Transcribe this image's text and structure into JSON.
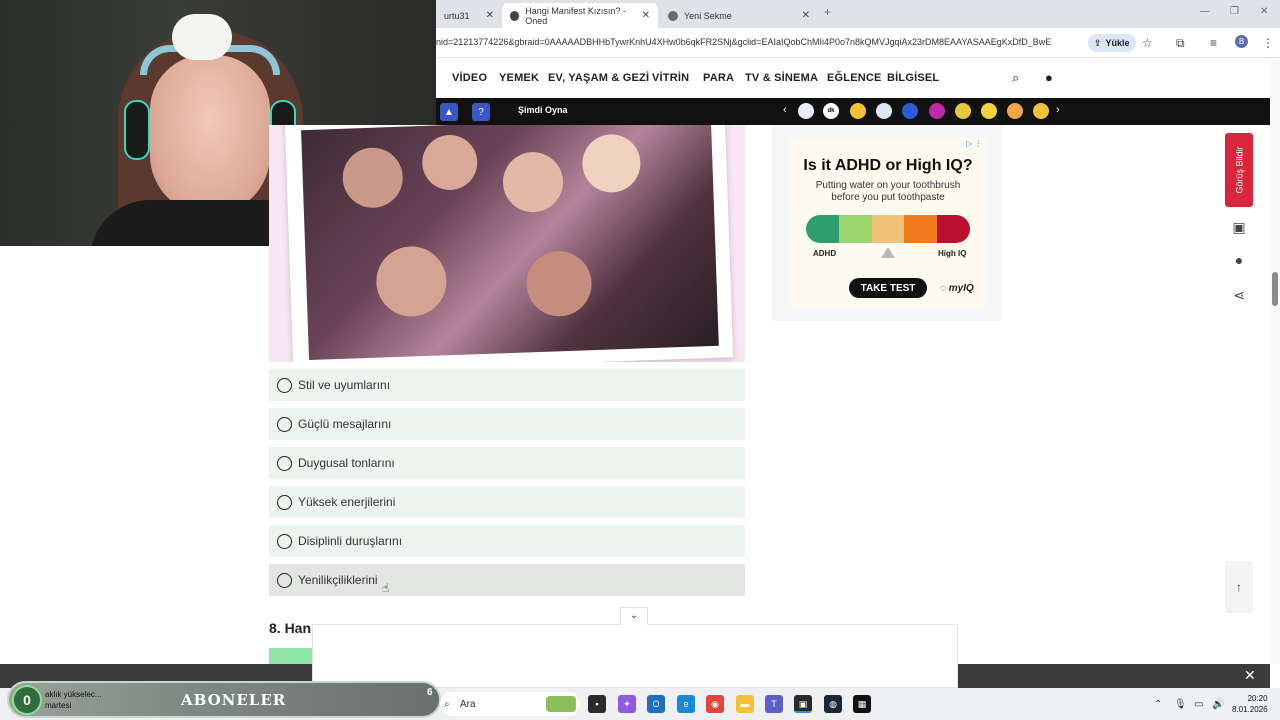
{
  "browser": {
    "tabs": [
      {
        "label": "urtu31"
      },
      {
        "label": "Hangi Manifest Kızısın? - Oned"
      },
      {
        "label": "Yeni Sekme"
      }
    ],
    "new_tab_label": "+",
    "url": "nid=21213774226&gbraid=0AAAAADBHHbTywrKnhU4XHw0b6qkFR2SNj&gclid=EAIaIQobChMIi4P0o7n8kQMVJgqiAx23rDM8EAAYASAAEgKxDfD_BwE",
    "upload_label": "Yükle",
    "profile_initial": "B"
  },
  "site_nav": {
    "items": [
      "VİDEO",
      "YEMEK",
      "EV, YAŞAM & GEZİ",
      "VİTRİN",
      "PARA",
      "TV & SİNEMA",
      "EĞLENCE",
      "BİLGİSEL"
    ]
  },
  "strip": {
    "play_label": "Şimdi Oyna",
    "help_label": "?",
    "chips": [
      "",
      "dk",
      "",
      "",
      "",
      "",
      "",
      "",
      "",
      "",
      ""
    ]
  },
  "quiz": {
    "options": [
      "Stil ve uyumlarını",
      "Güçlü mesajlarını",
      "Duygusal tonlarını",
      "Yüksek enerjilerini",
      "Disiplinli duruşlarını",
      "Yenilikçiliklerini"
    ],
    "hovered_index": 5,
    "next_question": "8. Han"
  },
  "ad": {
    "title": "Is it ADHD or High IQ?",
    "subtitle_line1": "Putting water on your toothbrush",
    "subtitle_line2": "before you put toothpaste",
    "low_label": "ADHD",
    "high_label": "High IQ",
    "button_label": "TAKE TEST",
    "brand": "myIQ",
    "meter_colors": [
      "#2e9e6e",
      "#9bd66e",
      "#f1c27a",
      "#ef7a1c",
      "#b8102e"
    ]
  },
  "right_tools": {
    "feedback_label": "Görüş Bildir"
  },
  "subscribers": {
    "count": "0",
    "line1": "aklık yükselec...",
    "line2": "martesi",
    "title": "ABONELER",
    "goal": "6"
  },
  "taskbar": {
    "search_placeholder": "Ara",
    "time": "20:20",
    "date": "8.01.2026"
  }
}
